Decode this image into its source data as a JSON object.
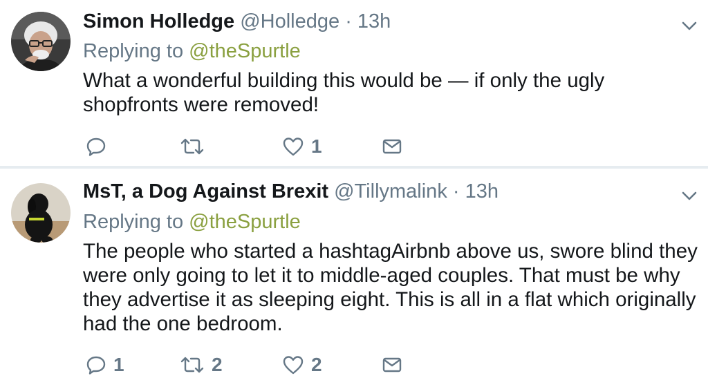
{
  "tweets": [
    {
      "name": "Simon Holledge",
      "handle": "@Holledge",
      "time": "· 13h",
      "replying_prefix": "Replying to",
      "replying_handle": "@theSpurtle",
      "text": "What a wonderful building this would be — if only the ugly shopfronts were removed!",
      "reply_count": "",
      "retweet_count": "",
      "like_count": "1",
      "avatar_icon": "man-with-glasses-avatar",
      "caret_icon": "chevron-down-icon"
    },
    {
      "name": "MsT, a Dog Against Brexit",
      "handle": "@Tillymalink",
      "time": "· 13h",
      "replying_prefix": "Replying to",
      "replying_handle": "@theSpurtle",
      "text": "The people who started a hashtagAirbnb above us, swore blind they were only going to let it to middle-aged couples. That must be why they advertise it as sleeping eight. This is all in a flat which originally had the one bedroom.",
      "reply_count": "1",
      "retweet_count": "2",
      "like_count": "2",
      "avatar_icon": "black-dog-avatar",
      "caret_icon": "chevron-down-icon"
    }
  ],
  "colors": {
    "text": "#14171a",
    "secondary": "#657786",
    "mention": "#8aa040",
    "divider": "#e6ecf0"
  }
}
